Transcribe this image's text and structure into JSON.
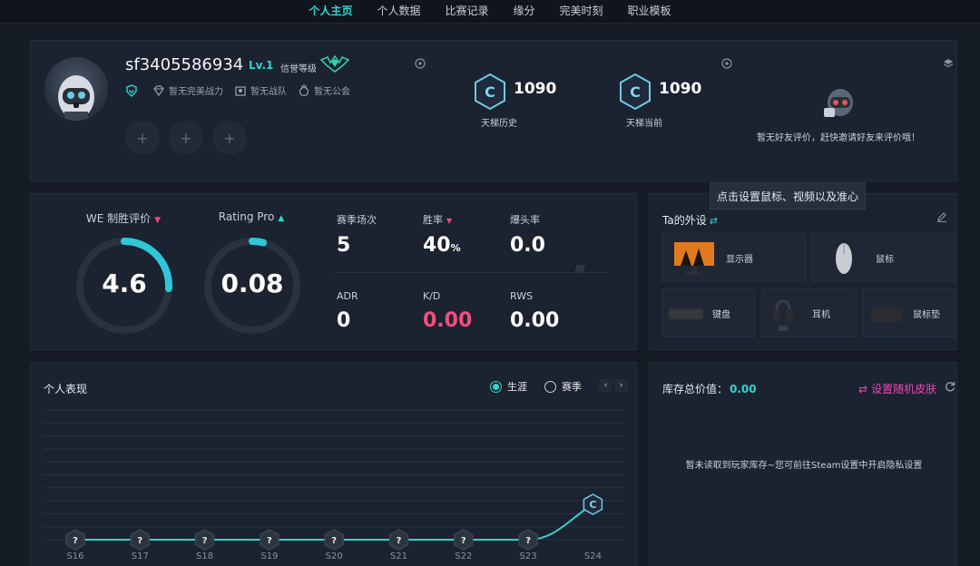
{
  "nav": {
    "tabs": [
      {
        "label": "个人主页",
        "active": true
      },
      {
        "label": "个人数据",
        "active": false
      },
      {
        "label": "比赛记录",
        "active": false
      },
      {
        "label": "缘分",
        "active": false
      },
      {
        "label": "完美时刻",
        "active": false
      },
      {
        "label": "职业模板",
        "active": false
      }
    ]
  },
  "profile": {
    "username": "sf3405586934",
    "level": "Lv.1",
    "credit_label": "信誉等级",
    "badges": [
      {
        "icon": "shield-icon",
        "label": ""
      },
      {
        "icon": "diamond-icon",
        "label": "暂无完美战力"
      },
      {
        "icon": "team-icon",
        "label": "暂无战队"
      },
      {
        "icon": "guild-icon",
        "label": "暂无公会"
      }
    ],
    "slots": [
      "+",
      "+",
      "+"
    ],
    "ladder_history": {
      "value": "1090",
      "caption": "天梯历史",
      "rank_letter": "C"
    },
    "ladder_current": {
      "value": "1090",
      "caption": "天梯当前",
      "rank_letter": "C"
    },
    "friend_review": "暂无好友评价，赶快邀请好友来评价哦！"
  },
  "stats": {
    "we_rating": {
      "label": "WE 制胜评价",
      "value": "4.6",
      "fraction": 0.26,
      "trend": "down"
    },
    "rating_pro": {
      "label": "Rating Pro",
      "value": "0.08",
      "fraction": 0.04,
      "trend": "up"
    },
    "items": [
      {
        "label": "赛季场次",
        "value": "5"
      },
      {
        "label": "胜率",
        "value": "40",
        "unit": "%",
        "trend": "down"
      },
      {
        "label": "爆头率",
        "value": "0.0"
      },
      {
        "label": "ADR",
        "value": "0"
      },
      {
        "label": "K/D",
        "value": "0.00",
        "highlight": true
      },
      {
        "label": "RWS",
        "value": "0.00"
      }
    ],
    "hatch": "////"
  },
  "gear": {
    "title": "Ta的外设",
    "tooltip": "点击设置鼠标、视频以及准心",
    "items": [
      {
        "icon": "monitor-icon",
        "label": "显示器"
      },
      {
        "icon": "mouse-icon",
        "label": "鼠标"
      },
      {
        "icon": "keyboard-icon",
        "label": "键盘"
      },
      {
        "icon": "headset-icon",
        "label": "耳机"
      },
      {
        "icon": "mousepad-icon",
        "label": "鼠标垫"
      }
    ]
  },
  "performance": {
    "title": "个人表现",
    "options": [
      {
        "label": "生涯",
        "selected": true
      },
      {
        "label": "赛季",
        "selected": false
      }
    ],
    "pager": [
      "‹",
      "›"
    ],
    "accent": "#2fd6d0"
  },
  "inventory": {
    "title": "库存总价值：",
    "value": "0.00",
    "random_skin": "设置随机皮肤",
    "empty_message": "暂未读取到玩家库存~您可前往Steam设置中开启隐私设置"
  },
  "chart_data": {
    "type": "line",
    "categories": [
      "S16",
      "S17",
      "S18",
      "S19",
      "S20",
      "S21",
      "S22",
      "S23",
      "S24"
    ],
    "series": [
      {
        "rank_marks": [
          "?",
          "?",
          "?",
          "?",
          "?",
          "?",
          "?",
          "?",
          "C"
        ],
        "values": [
          0,
          0,
          0,
          0,
          0,
          0,
          0,
          0,
          1
        ]
      }
    ],
    "grid": true
  }
}
